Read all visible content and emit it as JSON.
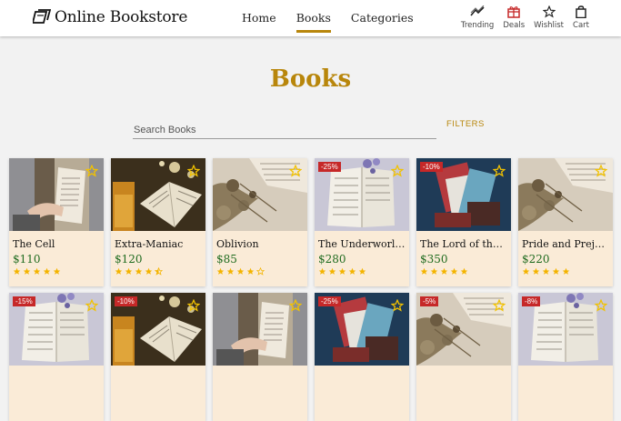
{
  "header": {
    "brand": "Online Bookstore",
    "nav": [
      {
        "label": "Home",
        "active": false
      },
      {
        "label": "Books",
        "active": true
      },
      {
        "label": "Categories",
        "active": false
      }
    ],
    "actions": [
      {
        "label": "Trending",
        "icon": "trending-icon"
      },
      {
        "label": "Deals",
        "icon": "gift-icon"
      },
      {
        "label": "Wishlist",
        "icon": "star-outline-icon"
      },
      {
        "label": "Cart",
        "icon": "shopping-bag-icon"
      }
    ]
  },
  "main": {
    "title": "Books",
    "search_placeholder": "Search Books",
    "filters_label": "FILTERS"
  },
  "colors": {
    "accent": "#b8860b",
    "card_bg": "#faebd7",
    "price": "#1f6b1f",
    "discount": "#c62828",
    "star": "#f4b400"
  },
  "books": [
    {
      "title": "The Cell",
      "price": "$110",
      "rating": 5,
      "discount": "",
      "cover": "hands-reading"
    },
    {
      "title": "Extra-Maniac",
      "price": "$120",
      "rating": 4.5,
      "discount": "",
      "cover": "book-drink"
    },
    {
      "title": "Oblivion",
      "price": "$85",
      "rating": 4,
      "discount": "",
      "cover": "dried-flowers"
    },
    {
      "title": "The Underworlds",
      "price": "$280",
      "rating": 5,
      "discount": "-25%",
      "cover": "open-book-lavender"
    },
    {
      "title": "The Lord of the Rings",
      "price": "$350",
      "rating": 5,
      "discount": "-10%",
      "cover": "stacked-books"
    },
    {
      "title": "Pride and Prejudice",
      "price": "$220",
      "rating": 5,
      "discount": "",
      "cover": "dried-flowers"
    },
    {
      "title": "",
      "price": "",
      "rating": 0,
      "discount": "-15%",
      "cover": "open-book-lavender"
    },
    {
      "title": "",
      "price": "",
      "rating": 0,
      "discount": "-10%",
      "cover": "book-drink"
    },
    {
      "title": "",
      "price": "",
      "rating": 0,
      "discount": "",
      "cover": "hands-reading"
    },
    {
      "title": "",
      "price": "",
      "rating": 0,
      "discount": "-25%",
      "cover": "stacked-books"
    },
    {
      "title": "",
      "price": "",
      "rating": 0,
      "discount": "-5%",
      "cover": "dried-flowers"
    },
    {
      "title": "",
      "price": "",
      "rating": 0,
      "discount": "-8%",
      "cover": "open-book-lavender"
    }
  ]
}
